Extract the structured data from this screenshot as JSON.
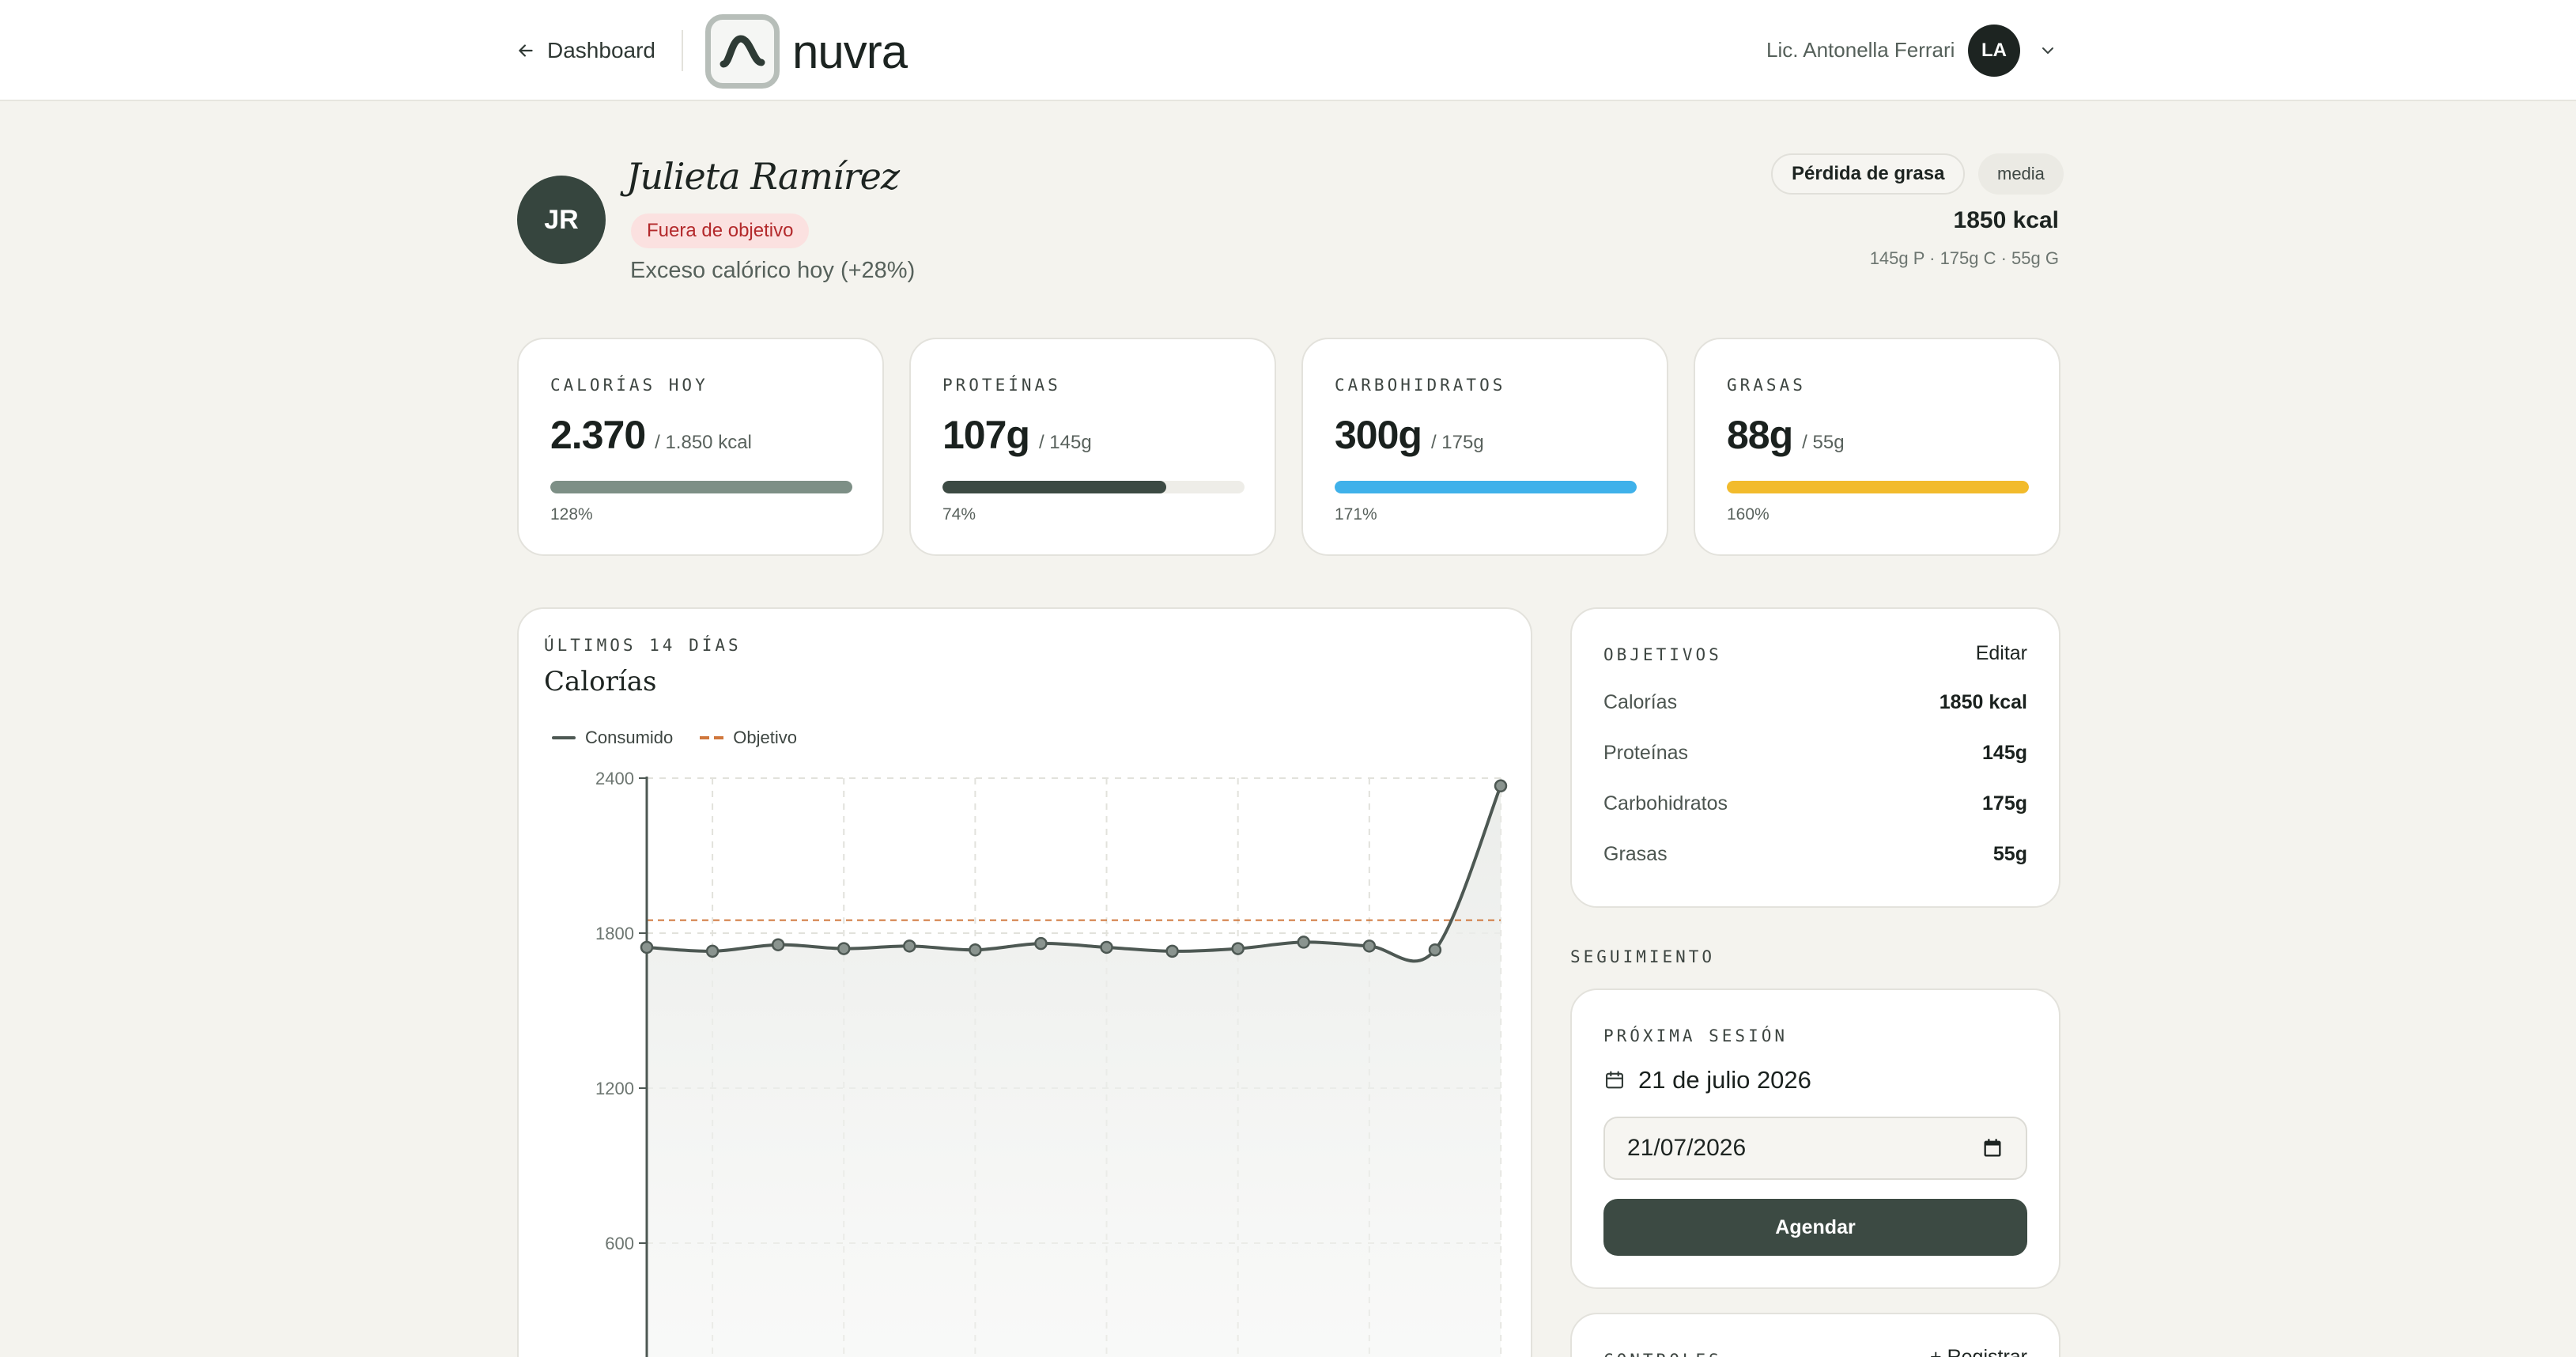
{
  "header": {
    "back_label": "Dashboard",
    "logo_text": "nuvra",
    "user_name": "Lic. Antonella Ferrari",
    "user_initials": "LA"
  },
  "patient": {
    "initials": "JR",
    "name": "Julieta Ramírez",
    "status_badge": "Fuera de objetivo",
    "status_detail": "Exceso calórico hoy (+28%)",
    "goal_type": "Pérdida de grasa",
    "goal_level": "media",
    "target_kcal": "1850 kcal",
    "target_macros": "145g P · 175g C · 55g G"
  },
  "stats": [
    {
      "label": "CALORÍAS HOY",
      "value": "2.370",
      "target": "/ 1.850 kcal",
      "pct_label": "128%",
      "fill_fraction": 1.0,
      "color": "#7d8f86"
    },
    {
      "label": "PROTEÍNAS",
      "value": "107g",
      "target": "/ 145g",
      "pct_label": "74%",
      "fill_fraction": 0.74,
      "color": "#3c4a43"
    },
    {
      "label": "CARBOHIDRATOS",
      "value": "300g",
      "target": "/ 175g",
      "pct_label": "171%",
      "fill_fraction": 1.0,
      "color": "#3fb1ea"
    },
    {
      "label": "GRASAS",
      "value": "88g",
      "target": "/ 55g",
      "pct_label": "160%",
      "fill_fraction": 1.0,
      "color": "#f2bb2c"
    }
  ],
  "chart": {
    "kicker": "ÚLTIMOS 14 DÍAS",
    "title": "Calorías",
    "legend_consumed": "Consumido",
    "legend_target": "Objetivo"
  },
  "chart_data": {
    "type": "line",
    "x": [
      1,
      2,
      3,
      4,
      5,
      6,
      7,
      8,
      9,
      10,
      11,
      12,
      13,
      14
    ],
    "series": [
      {
        "name": "Consumido",
        "values": [
          1745,
          1730,
          1755,
          1740,
          1750,
          1735,
          1760,
          1745,
          1730,
          1740,
          1765,
          1750,
          1735,
          2370
        ]
      },
      {
        "name": "Objetivo",
        "values": [
          1850,
          1850,
          1850,
          1850,
          1850,
          1850,
          1850,
          1850,
          1850,
          1850,
          1850,
          1850,
          1850,
          1850
        ]
      }
    ],
    "yticks": [
      600,
      1200,
      1800,
      2400
    ],
    "ylim": [
      0,
      2400
    ],
    "grid": true,
    "legend_position": "top-left",
    "colors": {
      "consumed": "#4d5853",
      "target": "#d0773c"
    }
  },
  "goals": {
    "kicker": "OBJETIVOS",
    "edit_label": "Editar",
    "rows": [
      {
        "label": "Calorías",
        "value": "1850 kcal"
      },
      {
        "label": "Proteínas",
        "value": "145g"
      },
      {
        "label": "Carbohidratos",
        "value": "175g"
      },
      {
        "label": "Grasas",
        "value": "55g"
      }
    ]
  },
  "followup": {
    "kicker": "SEGUIMIENTO",
    "session_kicker": "PRÓXIMA SESIÓN",
    "session_date": "21 de julio 2026",
    "date_input_value": "21/07/2026",
    "schedule_label": "Agendar",
    "controls_kicker": "CONTROLES",
    "controls_add": "+ Registrar"
  }
}
